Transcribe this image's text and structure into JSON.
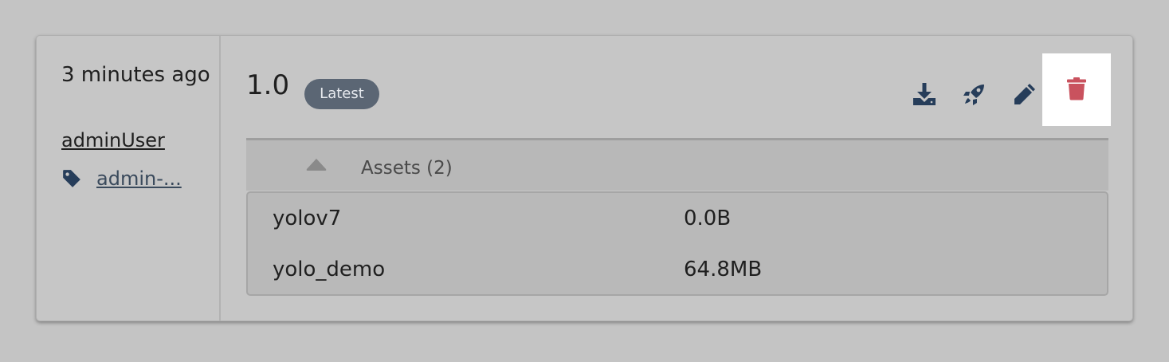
{
  "release": {
    "time": "3 minutes ago",
    "user": "adminUser",
    "tag": "admin-...",
    "version": "1.0",
    "badge": "Latest"
  },
  "actions": [
    {
      "name": "download",
      "icon": "download-icon"
    },
    {
      "name": "deploy",
      "icon": "rocket-icon"
    },
    {
      "name": "edit",
      "icon": "pencil-icon"
    },
    {
      "name": "delete",
      "icon": "trash-icon"
    }
  ],
  "assets": {
    "title": "Assets (2)",
    "rows": [
      {
        "name": "yolov7",
        "size": "0.0B"
      },
      {
        "name": "yolo_demo",
        "size": "64.8MB"
      }
    ]
  },
  "colors": {
    "icon": "#263d5a",
    "delete": "#c9525e",
    "badge_bg": "#5b6674"
  }
}
